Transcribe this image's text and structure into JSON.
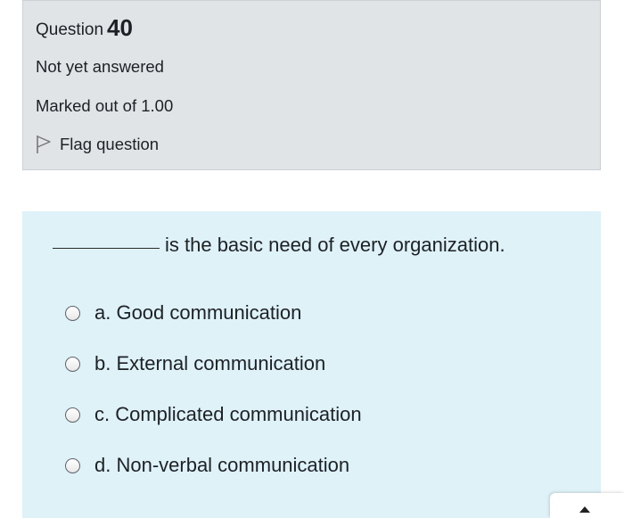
{
  "question_info": {
    "label": "Question",
    "number": "40",
    "state": "Not yet answered",
    "grade": "Marked out of 1.00",
    "flag_label": "Flag question",
    "flag_icon": "flag-outline-icon"
  },
  "question": {
    "text": "is the basic need of every organization.",
    "options": [
      {
        "label": "a. Good communication"
      },
      {
        "label": "b. External communication"
      },
      {
        "label": "c. Complicated communication"
      },
      {
        "label": "d. Non-verbal communication"
      }
    ]
  },
  "colors": {
    "info_background": "#e1e4e7",
    "content_background": "#def2f8",
    "text": "#1d2125"
  }
}
